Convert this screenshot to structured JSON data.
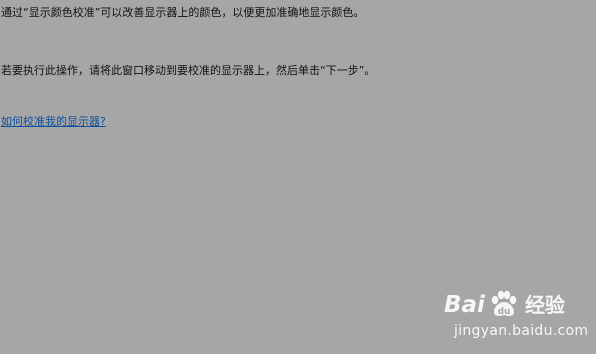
{
  "content": {
    "line1": "通过“显示颜色校准”可以改善显示器上的颜色，以便更加准确地显示颜色。",
    "line2": "若要执行此操作，请将此窗口移动到要校准的显示器上，然后单击“下一步”。",
    "help_link": "如何校准我的显示器?"
  },
  "watermark": {
    "brand_left": "Bai",
    "brand_right": "经验",
    "url": "jingyan.baidu.com",
    "logo_icon": "baidu-paw-icon"
  },
  "colors": {
    "background": "#a6a6a6",
    "text": "#111111",
    "link": "#0b4f9c",
    "watermark": "#ffffff"
  }
}
